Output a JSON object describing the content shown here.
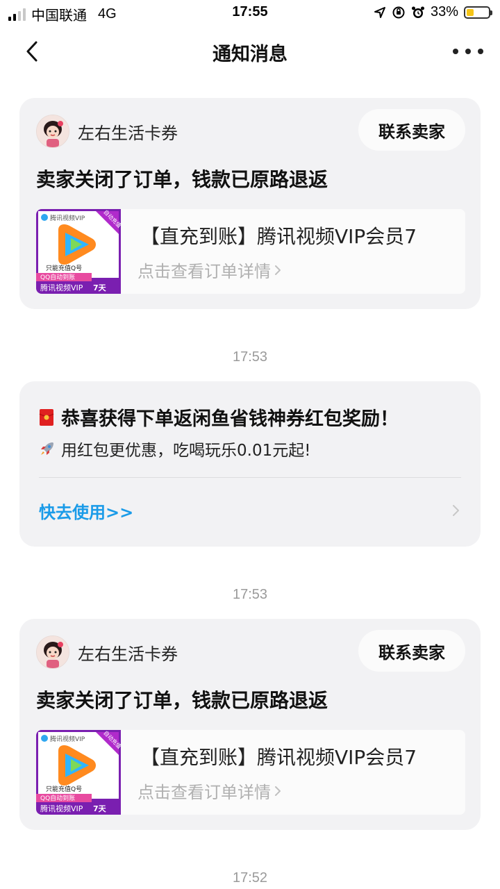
{
  "status_bar": {
    "carrier": "中国联通",
    "network": "4G",
    "time": "17:55",
    "battery_percent": "33%",
    "battery_level": 0.33
  },
  "nav": {
    "title": "通知消息",
    "back_icon": "chevron-left-icon",
    "more_icon": "more-dots-icon"
  },
  "timestamps": [
    "17:53",
    "17:53",
    "17:52"
  ],
  "cards": [
    {
      "seller": "左右生活卡券",
      "contact_label": "联系卖家",
      "message": "卖家关闭了订单，钱款已原路退返",
      "product_title": "【直充到账】腾讯视频VIP会员7",
      "product_link": "点击查看订单详情",
      "thumb": {
        "brand": "腾讯视频VIP",
        "corner": "自动充值",
        "note": "只能充值Q号",
        "banner": "QQ自动到账",
        "footer_brand": "腾讯视频VIP",
        "footer_days": "7天"
      }
    },
    {
      "seller": "左右生活卡券",
      "contact_label": "联系卖家",
      "message": "卖家关闭了订单，钱款已原路退返",
      "product_title": "【直充到账】腾讯视频VIP会员7",
      "product_link": "点击查看订单详情",
      "thumb": {
        "brand": "腾讯视频VIP",
        "corner": "自动充值",
        "note": "只能充值Q号",
        "banner": "QQ自动到账",
        "footer_brand": "腾讯视频VIP",
        "footer_days": "7天"
      }
    }
  ],
  "promo": {
    "title": "恭喜获得下单返闲鱼省钱神券红包奖励！",
    "subtitle": "用红包更优惠，吃喝玩乐0.01元起!",
    "link": "快去使用>>",
    "title_icon": "red-envelope-icon",
    "subtitle_icon": "rocket-icon"
  },
  "colors": {
    "card_bg": "#f2f2f4",
    "link_blue": "#1a9be8",
    "timestamp_gray": "#9a9a9a",
    "thumb_purple": "#7a1fb0"
  }
}
